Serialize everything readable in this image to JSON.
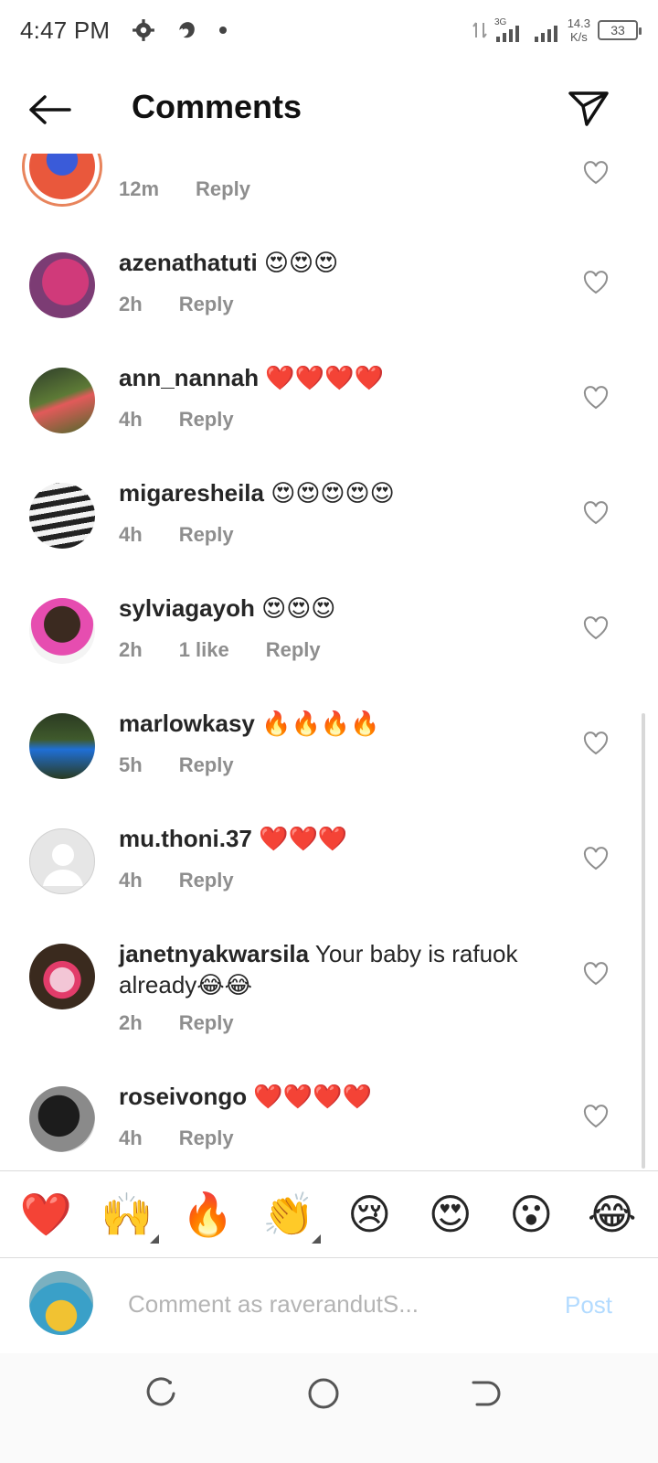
{
  "status_bar": {
    "time": "4:47 PM",
    "network_type": "3G",
    "net_speed_value": "14.3",
    "net_speed_unit": "K/s",
    "battery": "33"
  },
  "header": {
    "title": "Comments",
    "back_icon": "arrow-left-icon",
    "send_icon": "paper-plane-icon"
  },
  "comments": [
    {
      "user": "",
      "text": "",
      "time": "12m",
      "reply": "Reply",
      "likes": ""
    },
    {
      "user": "azenathatuti",
      "text": "😍😍😍",
      "time": "2h",
      "reply": "Reply",
      "likes": ""
    },
    {
      "user": "ann_nannah",
      "text": "❤️❤️❤️❤️",
      "time": "4h",
      "reply": "Reply",
      "likes": ""
    },
    {
      "user": "migaresheila",
      "text": "😍😍😍😍😍",
      "time": "4h",
      "reply": "Reply",
      "likes": ""
    },
    {
      "user": "sylviagayoh",
      "text": "😍😍😍",
      "time": "2h",
      "reply": "Reply",
      "likes": "1 like"
    },
    {
      "user": "marlowkasy",
      "text": "🔥🔥🔥🔥",
      "time": "5h",
      "reply": "Reply",
      "likes": ""
    },
    {
      "user": "mu.thoni.37",
      "text": "❤️❤️❤️",
      "time": "4h",
      "reply": "Reply",
      "likes": ""
    },
    {
      "user": "janetnyakwarsila",
      "text": "Your baby is rafuok already😂😂",
      "time": "2h",
      "reply": "Reply",
      "likes": ""
    },
    {
      "user": "roseivongo",
      "text": "❤️❤️❤️❤️",
      "time": "4h",
      "reply": "Reply",
      "likes": ""
    }
  ],
  "emoji_bar": [
    "❤️",
    "🙌",
    "🔥",
    "👏",
    "😢",
    "😍",
    "😮",
    "😂"
  ],
  "input": {
    "placeholder": "Comment as raverandutS...",
    "post_label": "Post"
  },
  "colors": {
    "muted_text": "#8e8e8e",
    "post_disabled": "#b3dbff",
    "story_ring": "#e8845c",
    "heart_red": "#ed4956"
  }
}
